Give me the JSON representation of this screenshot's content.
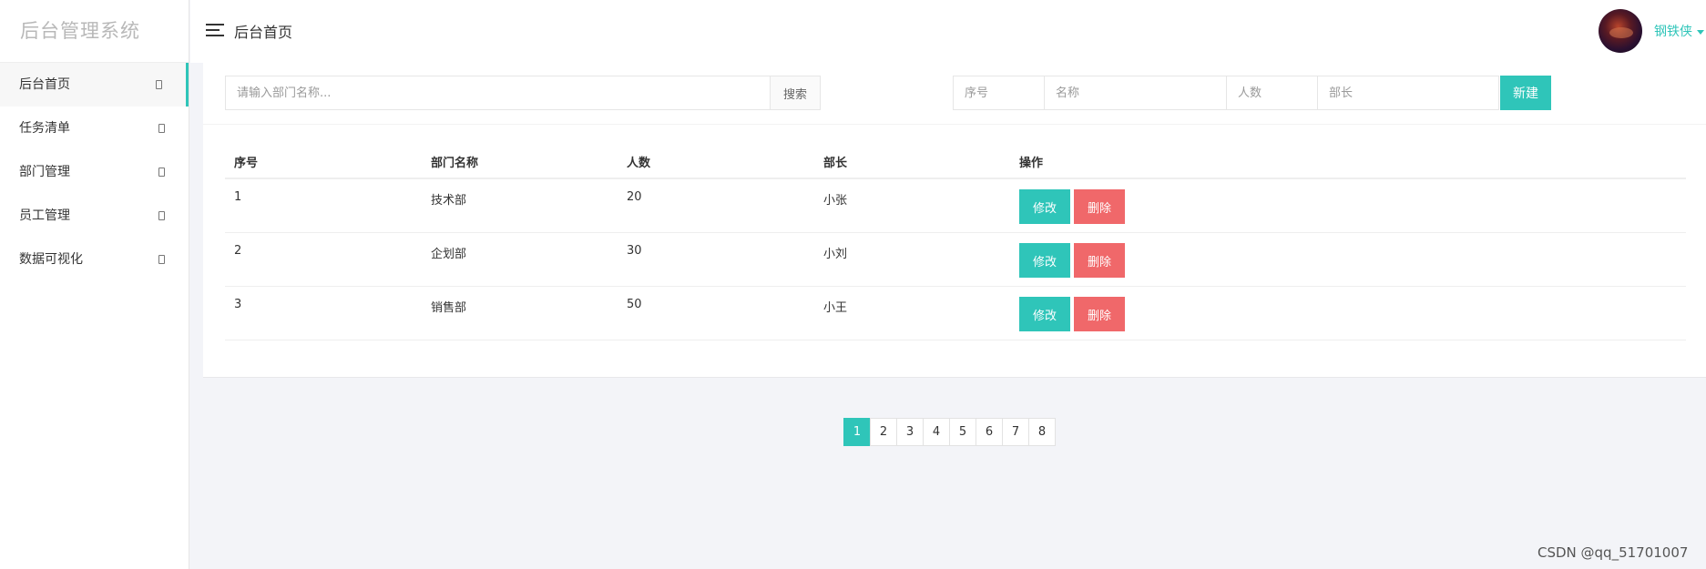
{
  "sidebar": {
    "logo": "后台管理系统",
    "items": [
      {
        "label": "后台首页",
        "active": true
      },
      {
        "label": "任务清单",
        "active": false
      },
      {
        "label": "部门管理",
        "active": false
      },
      {
        "label": "员工管理",
        "active": false
      },
      {
        "label": "数据可视化",
        "active": false
      }
    ]
  },
  "header": {
    "title": "后台首页",
    "username": "钢铁侠",
    "icons": [
      "hamburger-icon",
      "chevron-down-icon"
    ]
  },
  "search": {
    "placeholder": "请输入部门名称...",
    "button_label": "搜索"
  },
  "new_form": {
    "placeholders": {
      "no": "序号",
      "name": "名称",
      "count": "人数",
      "head": "部长"
    },
    "button_label": "新建"
  },
  "table": {
    "columns": [
      "序号",
      "部门名称",
      "人数",
      "部长",
      "操作"
    ],
    "rows": [
      {
        "no": "1",
        "name": "技术部",
        "count": "20",
        "head": "小张",
        "edit": "修改",
        "delete": "删除"
      },
      {
        "no": "2",
        "name": "企划部",
        "count": "30",
        "head": "小刘",
        "edit": "修改",
        "delete": "删除"
      },
      {
        "no": "3",
        "name": "销售部",
        "count": "50",
        "head": "小王",
        "edit": "修改",
        "delete": "删除"
      }
    ]
  },
  "pagination": {
    "pages": [
      "1",
      "2",
      "3",
      "4",
      "5",
      "6",
      "7",
      "8"
    ],
    "current": "1"
  },
  "watermark": "CSDN @qq_51701007",
  "colors": {
    "accent": "#2fc5b9",
    "danger": "#f0686a",
    "background": "#f3f4f8"
  }
}
